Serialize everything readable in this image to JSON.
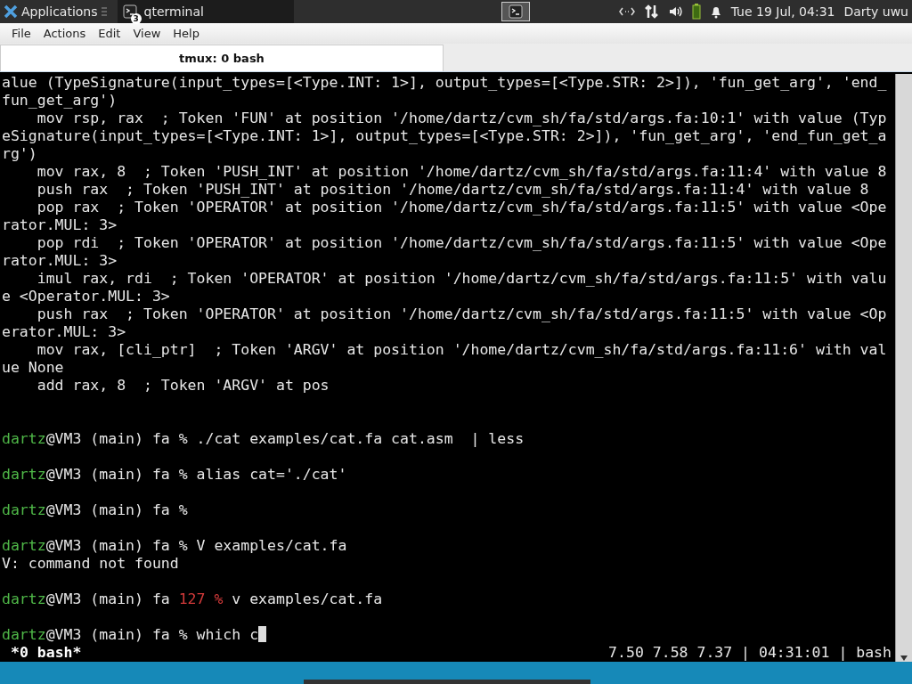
{
  "panel": {
    "menu_label": "Applications",
    "tasks": [
      {
        "label": "qterminal",
        "badge": "3",
        "selected": true
      }
    ],
    "clock": "Tue 19 Jul, 04:31",
    "user": "Darty uwu"
  },
  "window": {
    "menu": [
      "File",
      "Actions",
      "Edit",
      "View",
      "Help"
    ],
    "tabs": [
      {
        "label": "tmux: 0 bash",
        "selected": true
      }
    ],
    "terminal": {
      "lines": [
        {
          "segments": [
            {
              "kind": "plain",
              "text": "alue (TypeSignature(input_types=[<Type.INT: 1>], output_types=[<Type.STR: 2>]), 'fun_get_arg', 'end_"
            }
          ]
        },
        {
          "segments": [
            {
              "kind": "plain",
              "text": "fun_get_arg')"
            }
          ]
        },
        {
          "segments": [
            {
              "kind": "plain",
              "text": "    mov rsp, rax  ; Token 'FUN' at position '/home/dartz/cvm_sh/fa/std/args.fa:10:1' with value (Typ"
            }
          ]
        },
        {
          "segments": [
            {
              "kind": "plain",
              "text": "eSignature(input_types=[<Type.INT: 1>], output_types=[<Type.STR: 2>]), 'fun_get_arg', 'end_fun_get_a"
            }
          ]
        },
        {
          "segments": [
            {
              "kind": "plain",
              "text": "rg')"
            }
          ]
        },
        {
          "segments": [
            {
              "kind": "plain",
              "text": "    mov rax, 8  ; Token 'PUSH_INT' at position '/home/dartz/cvm_sh/fa/std/args.fa:11:4' with value 8"
            }
          ]
        },
        {
          "segments": [
            {
              "kind": "plain",
              "text": "    push rax  ; Token 'PUSH_INT' at position '/home/dartz/cvm_sh/fa/std/args.fa:11:4' with value 8"
            }
          ]
        },
        {
          "segments": [
            {
              "kind": "plain",
              "text": "    pop rax  ; Token 'OPERATOR' at position '/home/dartz/cvm_sh/fa/std/args.fa:11:5' with value <Ope"
            }
          ]
        },
        {
          "segments": [
            {
              "kind": "plain",
              "text": "rator.MUL: 3>"
            }
          ]
        },
        {
          "segments": [
            {
              "kind": "plain",
              "text": "    pop rdi  ; Token 'OPERATOR' at position '/home/dartz/cvm_sh/fa/std/args.fa:11:5' with value <Ope"
            }
          ]
        },
        {
          "segments": [
            {
              "kind": "plain",
              "text": "rator.MUL: 3>"
            }
          ]
        },
        {
          "segments": [
            {
              "kind": "plain",
              "text": "    imul rax, rdi  ; Token 'OPERATOR' at position '/home/dartz/cvm_sh/fa/std/args.fa:11:5' with valu"
            }
          ]
        },
        {
          "segments": [
            {
              "kind": "plain",
              "text": "e <Operator.MUL: 3>"
            }
          ]
        },
        {
          "segments": [
            {
              "kind": "plain",
              "text": "    push rax  ; Token 'OPERATOR' at position '/home/dartz/cvm_sh/fa/std/args.fa:11:5' with value <Op"
            }
          ]
        },
        {
          "segments": [
            {
              "kind": "plain",
              "text": "erator.MUL: 3>"
            }
          ]
        },
        {
          "segments": [
            {
              "kind": "plain",
              "text": "    mov rax, [cli_ptr]  ; Token 'ARGV' at position '/home/dartz/cvm_sh/fa/std/args.fa:11:6' with val"
            }
          ]
        },
        {
          "segments": [
            {
              "kind": "plain",
              "text": "ue None"
            }
          ]
        },
        {
          "segments": [
            {
              "kind": "plain",
              "text": "    add rax, 8  ; Token 'ARGV' at pos"
            }
          ]
        },
        {
          "kind": "blank"
        },
        {
          "kind": "blank"
        },
        {
          "segments": [
            {
              "kind": "user",
              "text": "dartz"
            },
            {
              "kind": "plain",
              "text": "@VM3 (main) fa % ./cat examples/cat.fa cat.asm  | less"
            }
          ]
        },
        {
          "kind": "blank"
        },
        {
          "segments": [
            {
              "kind": "user",
              "text": "dartz"
            },
            {
              "kind": "plain",
              "text": "@VM3 (main) fa % alias cat='./cat'"
            }
          ]
        },
        {
          "kind": "blank"
        },
        {
          "segments": [
            {
              "kind": "user",
              "text": "dartz"
            },
            {
              "kind": "plain",
              "text": "@VM3 (main) fa %"
            }
          ]
        },
        {
          "kind": "blank"
        },
        {
          "segments": [
            {
              "kind": "user",
              "text": "dartz"
            },
            {
              "kind": "plain",
              "text": "@VM3 (main) fa % V examples/cat.fa"
            }
          ]
        },
        {
          "segments": [
            {
              "kind": "plain",
              "text": "V: command not found"
            }
          ]
        },
        {
          "kind": "blank"
        },
        {
          "segments": [
            {
              "kind": "user",
              "text": "dartz"
            },
            {
              "kind": "plain",
              "text": "@VM3 (main) fa "
            },
            {
              "kind": "error",
              "text": "127 %"
            },
            {
              "kind": "plain",
              "text": " v examples/cat.fa"
            }
          ]
        },
        {
          "kind": "blank"
        },
        {
          "segments": [
            {
              "kind": "user",
              "text": "dartz"
            },
            {
              "kind": "plain",
              "text": "@VM3 (main) fa % which c"
            }
          ],
          "cursor": true
        }
      ],
      "status_left": "*0 bash*",
      "status_right": "7.50 7.58 7.37 | 04:31:01 | bash"
    }
  }
}
